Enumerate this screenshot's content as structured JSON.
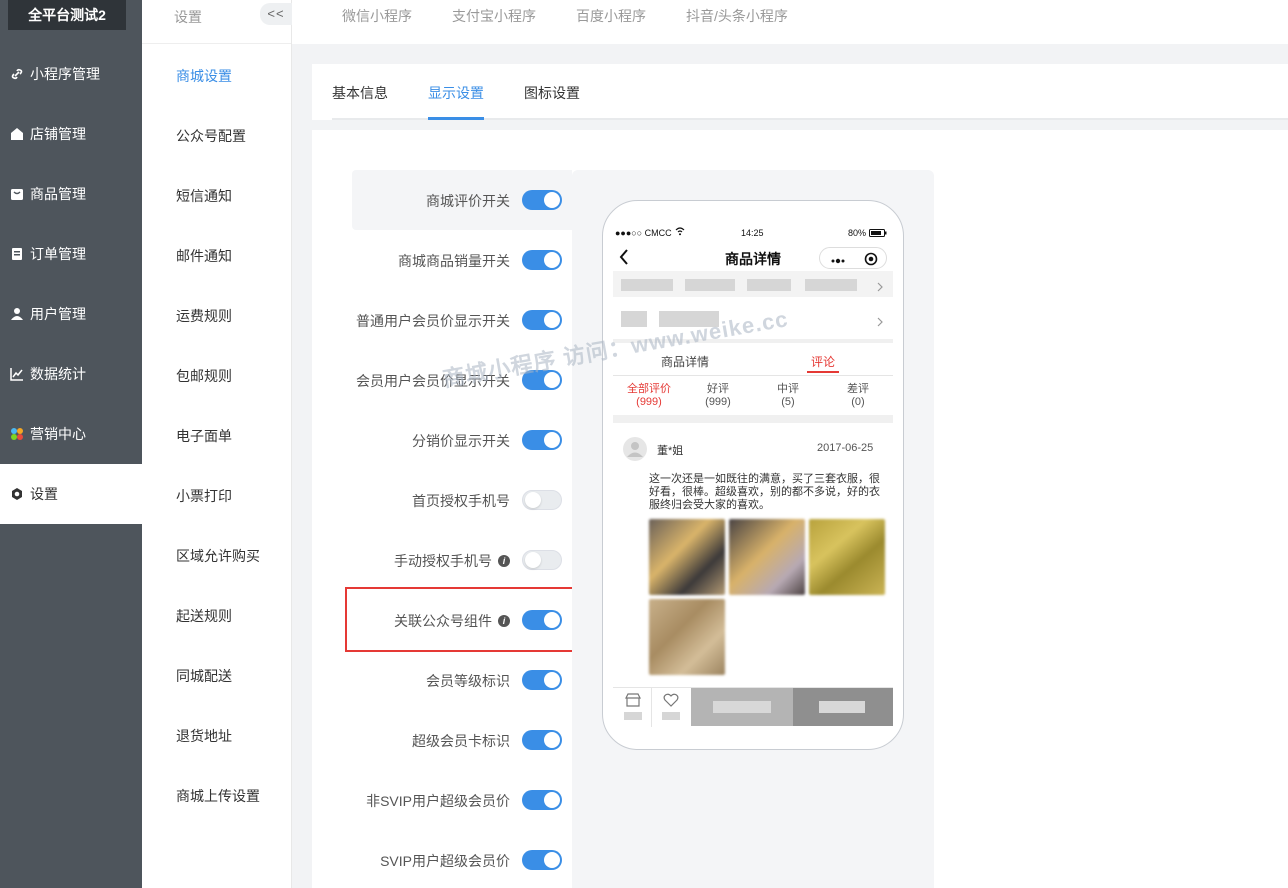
{
  "app": {
    "title": "全平台测试2"
  },
  "sidebar": {
    "items": [
      {
        "label": "小程序管理",
        "icon": "link-icon"
      },
      {
        "label": "店铺管理",
        "icon": "store-icon"
      },
      {
        "label": "商品管理",
        "icon": "goods-icon"
      },
      {
        "label": "订单管理",
        "icon": "order-icon"
      },
      {
        "label": "用户管理",
        "icon": "user-icon"
      },
      {
        "label": "数据统计",
        "icon": "chart-icon"
      },
      {
        "label": "营销中心",
        "icon": "marketing-icon"
      },
      {
        "label": "设置",
        "icon": "gear-icon"
      }
    ],
    "active_index": 7
  },
  "submenu": {
    "title": "设置",
    "collapse_label": "<<",
    "items": [
      "商城设置",
      "公众号配置",
      "短信通知",
      "邮件通知",
      "运费规则",
      "包邮规则",
      "电子面单",
      "小票打印",
      "区域允许购买",
      "起送规则",
      "同城配送",
      "退货地址",
      "商城上传设置"
    ],
    "active_index": 0
  },
  "platform_tabs": [
    "微信小程序",
    "支付宝小程序",
    "百度小程序",
    "抖音/头条小程序"
  ],
  "content_tabs": {
    "items": [
      "基本信息",
      "显示设置",
      "图标设置"
    ],
    "active_index": 1
  },
  "settings": [
    {
      "label": "商城评价开关",
      "on": true,
      "info": false
    },
    {
      "label": "商城商品销量开关",
      "on": true,
      "info": false
    },
    {
      "label": "普通用户会员价显示开关",
      "on": true,
      "info": false
    },
    {
      "label": "会员用户会员价显示开关",
      "on": true,
      "info": false
    },
    {
      "label": "分销价显示开关",
      "on": true,
      "info": false
    },
    {
      "label": "首页授权手机号",
      "on": false,
      "info": false
    },
    {
      "label": "手动授权手机号",
      "on": false,
      "info": true
    },
    {
      "label": "关联公众号组件",
      "on": true,
      "info": true
    },
    {
      "label": "会员等级标识",
      "on": true,
      "info": false
    },
    {
      "label": "超级会员卡标识",
      "on": true,
      "info": false
    },
    {
      "label": "非SVIP用户超级会员价",
      "on": true,
      "info": false
    },
    {
      "label": "SVIP用户超级会员价",
      "on": true,
      "info": false
    }
  ],
  "phone": {
    "status": {
      "carrier": "●●●○○ CMCC",
      "time": "14:25",
      "battery": "80%"
    },
    "title": "商品详情",
    "tabs": [
      "商品详情",
      "评论"
    ],
    "review_filters": [
      {
        "label": "全部评价",
        "count": "(999)"
      },
      {
        "label": "好评",
        "count": "(999)"
      },
      {
        "label": "中评",
        "count": "(5)"
      },
      {
        "label": "差评",
        "count": "(0)"
      }
    ],
    "review": {
      "user": "董*姐",
      "date": "2017-06-25",
      "text": "这一次还是一如既往的满意，买了三套衣服，很好看，很棒。超级喜欢，别的都不多说，好的衣服终归会受大家的喜欢。"
    }
  },
  "watermark": "商城小程序 访问：www.weike.cc",
  "colors": {
    "accent": "#3a8ee6",
    "sidebar": "#4e555c",
    "highlight_border": "#e53935"
  }
}
